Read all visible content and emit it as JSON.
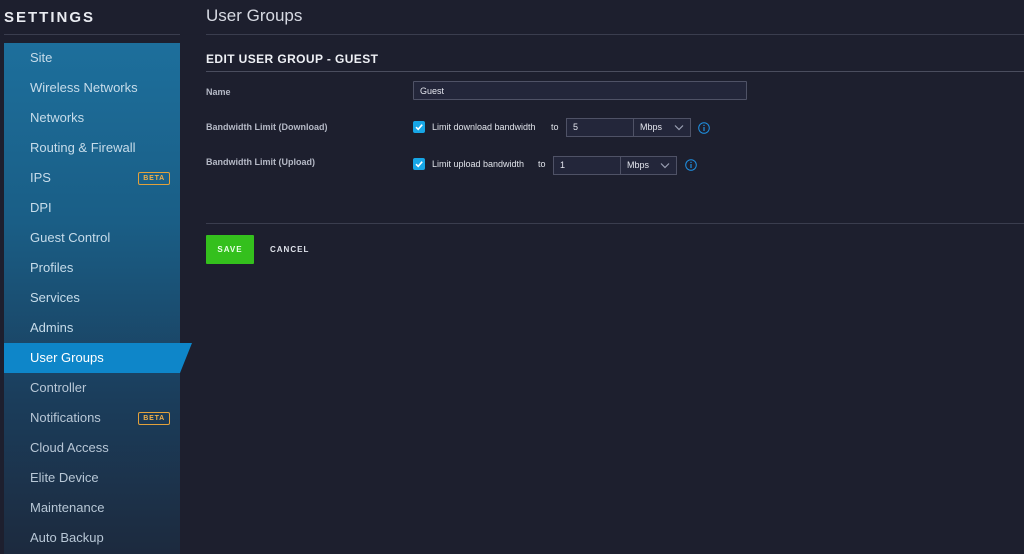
{
  "sidebar": {
    "title": "SETTINGS",
    "items": [
      {
        "label": "Site",
        "badge": ""
      },
      {
        "label": "Wireless Networks",
        "badge": ""
      },
      {
        "label": "Networks",
        "badge": ""
      },
      {
        "label": "Routing & Firewall",
        "badge": ""
      },
      {
        "label": "IPS",
        "badge": "BETA"
      },
      {
        "label": "DPI",
        "badge": ""
      },
      {
        "label": "Guest Control",
        "badge": ""
      },
      {
        "label": "Profiles",
        "badge": ""
      },
      {
        "label": "Services",
        "badge": ""
      },
      {
        "label": "Admins",
        "badge": ""
      },
      {
        "label": "User Groups",
        "badge": "",
        "active": true
      },
      {
        "label": "Controller",
        "badge": ""
      },
      {
        "label": "Notifications",
        "badge": "BETA"
      },
      {
        "label": "Cloud Access",
        "badge": ""
      },
      {
        "label": "Elite Device",
        "badge": ""
      },
      {
        "label": "Maintenance",
        "badge": ""
      },
      {
        "label": "Auto Backup",
        "badge": ""
      }
    ]
  },
  "main": {
    "page_title": "User Groups",
    "section_title": "EDIT USER GROUP - GUEST",
    "name_label": "Name",
    "name_value": "Guest",
    "download": {
      "label": "Bandwidth Limit (Download)",
      "checkbox_label": "Limit download bandwidth",
      "checked": true,
      "to": "to",
      "value": "5",
      "unit": "Mbps"
    },
    "upload": {
      "label": "Bandwidth Limit (Upload)",
      "checkbox_label": "Limit upload bandwidth",
      "checked": true,
      "to": "to",
      "value": "1",
      "unit": "Mbps"
    },
    "save_label": "SAVE",
    "cancel_label": "CANCEL"
  },
  "colors": {
    "accent": "#0e86c9",
    "save_green": "#34c01d",
    "checkbox_blue": "#17a6e6",
    "badge_orange": "#f0b049"
  }
}
